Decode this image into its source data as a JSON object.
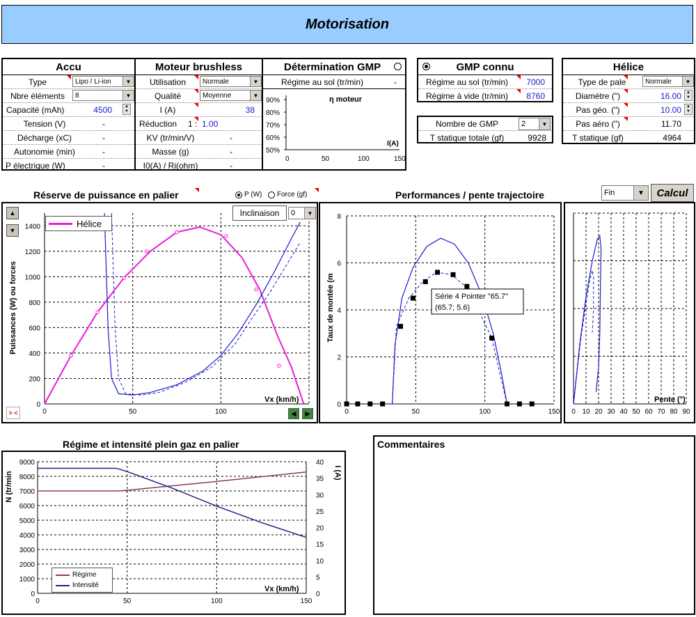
{
  "title": "Motorisation",
  "accu": {
    "header": "Accu",
    "rows": [
      {
        "label": "Type",
        "select": "Lipo / Li-ion"
      },
      {
        "label": "Nbre éléments",
        "select": "8"
      },
      {
        "label": "Capacité (mAh)",
        "value": "4500"
      },
      {
        "label": "Tension (V)",
        "value": "-"
      },
      {
        "label": "Décharge (xC)",
        "value": "-"
      },
      {
        "label": "Autonomie (min)",
        "value": "-"
      },
      {
        "label": "P électrique (W)",
        "value": "-"
      }
    ]
  },
  "moteur": {
    "header": "Moteur brushless",
    "rows": [
      {
        "label": "Utilisation",
        "select": "Normale"
      },
      {
        "label": "Qualité",
        "select": "Moyenne"
      },
      {
        "label": "I (A)",
        "value": "38"
      },
      {
        "label": "Réduction",
        "ratio_left": "1 :",
        "ratio_right": "1.00"
      },
      {
        "label": "KV (tr/min/V)",
        "value": "-"
      },
      {
        "label": "Masse (g)",
        "value": "-"
      },
      {
        "label": "I0(A) / Ri(ohm)",
        "value": "-"
      }
    ]
  },
  "determination": {
    "header": "Détermination GMP",
    "row_label": "Régime au sol (tr/min)",
    "row_value": "-",
    "chart": {
      "title": "η moteur",
      "xlabel": "I(A)",
      "xticks": [
        "0",
        "50",
        "100",
        "150"
      ],
      "yticks": [
        "90%",
        "80%",
        "70%",
        "60%",
        "50%"
      ]
    }
  },
  "gmp_connu": {
    "header": "GMP connu",
    "rows": [
      {
        "label": "Régime au sol  (tr/min)",
        "value": "7000"
      },
      {
        "label": "Régime à vide  (tr/min)",
        "value": "8760"
      }
    ],
    "nombre_label": "Nombre de GMP",
    "nombre_value": "2",
    "tstat_label": "T statique totale (gf)",
    "tstat_value": "9928"
  },
  "helice": {
    "header": "Hélice",
    "rows": [
      {
        "label": "Type de pale",
        "select": "Normale"
      },
      {
        "label": "Diamètre (\")",
        "value": "16.00"
      },
      {
        "label": "Pas géo. (\")",
        "value": "10.00"
      },
      {
        "label": "Pas aéro (\")",
        "value": "11.70"
      },
      {
        "label": "T statique (gf)",
        "value": "4964"
      }
    ]
  },
  "controls": {
    "fin_select": "Fin",
    "calcul_label": "Calcul",
    "radio_p": "P (W)",
    "radio_force": "Force (gf)",
    "inclinaison_label": "Inclinaison",
    "inclinaison_value": "0",
    "reset_label": "> <"
  },
  "chart1": {
    "title": "Réserve de puissance en palier",
    "ylabel": "Puissances (W) ou forces",
    "xlabel": "Vx (km/h)",
    "legend": "Hélice",
    "yticks": [
      "0",
      "200",
      "400",
      "600",
      "800",
      "1000",
      "1200",
      "1400"
    ],
    "xticks": [
      "0",
      "50",
      "100"
    ]
  },
  "chart2": {
    "title": "Performances / pente trajectoire",
    "ylabel": "Taux de montée (m",
    "yticks": [
      "0",
      "2",
      "4",
      "6",
      "8"
    ],
    "xticks": [
      "0",
      "50",
      "100",
      "150"
    ],
    "tooltip_line1": "Série 4 Pointer \"65.7\"",
    "tooltip_line2": "(65.7; 5.6)"
  },
  "chart3": {
    "xlabel": "Pente (°)",
    "xticks": [
      "0",
      "10",
      "20",
      "30",
      "40",
      "50",
      "60",
      "70",
      "80",
      "90"
    ]
  },
  "chart4": {
    "title": "Régime et intensité plein gaz en palier",
    "ylabel_left": "N (tr/min",
    "ylabel_right": "I (A)",
    "xlabel": "Vx (km/h)",
    "yticks_left": [
      "0",
      "1000",
      "2000",
      "3000",
      "4000",
      "5000",
      "6000",
      "7000",
      "8000",
      "9000"
    ],
    "yticks_right": [
      "0",
      "5",
      "10",
      "15",
      "20",
      "25",
      "30",
      "35",
      "40"
    ],
    "xticks": [
      "0",
      "50",
      "100",
      "150"
    ],
    "legend": [
      {
        "name": "Régime",
        "color": "#8b3a5a"
      },
      {
        "name": "Intensité",
        "color": "#1a237e"
      }
    ]
  },
  "comments": {
    "title": "Commentaires"
  }
}
